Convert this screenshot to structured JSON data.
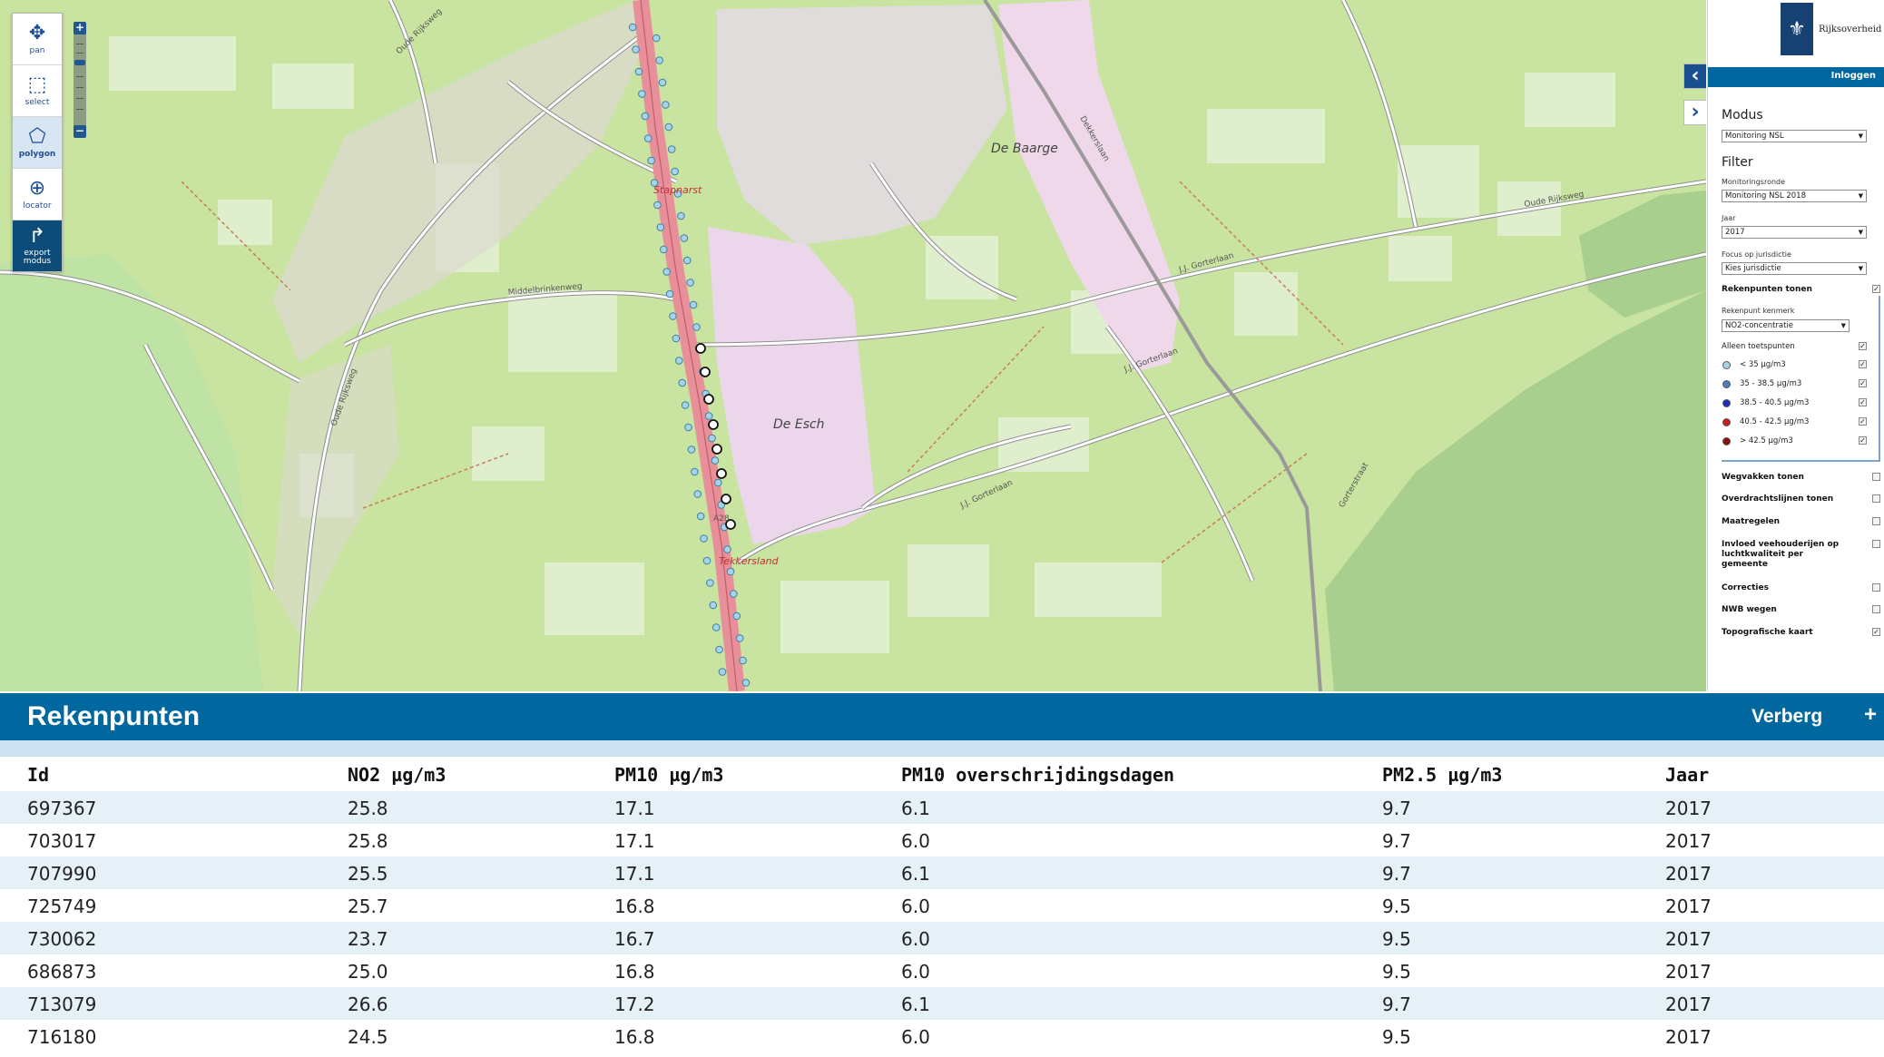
{
  "map": {
    "place_labels": [
      "De Baarge",
      "De Esch",
      "Stapnarst",
      "Tekkersland"
    ],
    "road_labels": [
      "Oude Rijksweg",
      "Oude Rijksweg",
      "J.J. Gorterlaan",
      "J.J. Gorterlaan",
      "J.J. Gorterlaan",
      "A28",
      "Dekkerslaan",
      "Middelbrinkenweg",
      "Gorterstraat",
      "Oude Rijksweg"
    ],
    "colors": {
      "grass": "#c9e3a0",
      "field": "#dfeecc",
      "residential": "#e2dede",
      "industrial": "#ebd9ea",
      "motorway": "#e8909a",
      "water": "#aad3df",
      "forest": "#a8cf8e"
    }
  },
  "tools": [
    {
      "icon": "pan-icon",
      "label": "pan"
    },
    {
      "icon": "select-icon",
      "label": "select"
    },
    {
      "icon": "polygon-icon",
      "label": "polygon"
    },
    {
      "icon": "locator-icon",
      "label": "locator"
    },
    {
      "icon": "export-icon",
      "label": "export\nmodus"
    }
  ],
  "zoom": {
    "in": "+",
    "out": "−"
  },
  "panel": {
    "logo_text": "Rijksoverheid",
    "login": "Inloggen",
    "modus_heading": "Modus",
    "modus_value": "Monitoring NSL",
    "filter_heading": "Filter",
    "monitoringsronde_label": "Monitoringsronde",
    "monitoringsronde_value": "Monitoring NSL 2018",
    "jaar_label": "Jaar",
    "jaar_value": "2017",
    "focus_label": "Focus op jurisdictie",
    "focus_value": "Kies jurisdictie",
    "rekenpunten_tonen": "Rekenpunten tonen",
    "rekenpunt_kenmerk_label": "Rekenpunt kenmerk",
    "rekenpunt_kenmerk_value": "NO2-concentratie",
    "alleen_toetspunten": "Alleen toetspunten",
    "legend": [
      {
        "label": "< 35 µg/m3",
        "color": "#a7d3e8"
      },
      {
        "label": "35 - 38.5 µg/m3",
        "color": "#4f7cc4"
      },
      {
        "label": "38.5 - 40.5 µg/m3",
        "color": "#1a2fb8"
      },
      {
        "label": "40.5 - 42.5 µg/m3",
        "color": "#cf1b1b"
      },
      {
        "label": "> 42.5 µg/m3",
        "color": "#8c0e0e"
      }
    ],
    "layers": [
      {
        "label": "Wegvakken tonen",
        "checked": false
      },
      {
        "label": "Overdrachtslijnen tonen",
        "checked": false
      },
      {
        "label": "Maatregelen",
        "checked": false
      },
      {
        "label": "Invloed veehouderijen op luchtkwaliteit per gemeente",
        "checked": false
      },
      {
        "label": "Correcties",
        "checked": false
      },
      {
        "label": "NWB wegen",
        "checked": false
      },
      {
        "label": "Topografische kaart",
        "checked": true
      }
    ]
  },
  "table": {
    "title": "Rekenpunten",
    "hide_label": "Verberg",
    "plus_label": "+",
    "columns": [
      "Id",
      "NO2 µg/m3",
      "PM10 µg/m3",
      "PM10 overschrijdingsdagen",
      "PM2.5 µg/m3",
      "Jaar"
    ],
    "rows": [
      [
        "697367",
        "25.8",
        "17.1",
        "6.1",
        "9.7",
        "2017"
      ],
      [
        "703017",
        "25.8",
        "17.1",
        "6.0",
        "9.7",
        "2017"
      ],
      [
        "707990",
        "25.5",
        "17.1",
        "6.1",
        "9.7",
        "2017"
      ],
      [
        "725749",
        "25.7",
        "16.8",
        "6.0",
        "9.5",
        "2017"
      ],
      [
        "730062",
        "23.7",
        "16.7",
        "6.0",
        "9.5",
        "2017"
      ],
      [
        "686873",
        "25.0",
        "16.8",
        "6.0",
        "9.5",
        "2017"
      ],
      [
        "713079",
        "26.6",
        "17.2",
        "6.1",
        "9.7",
        "2017"
      ],
      [
        "716180",
        "24.5",
        "16.8",
        "6.0",
        "9.5",
        "2017"
      ]
    ]
  }
}
